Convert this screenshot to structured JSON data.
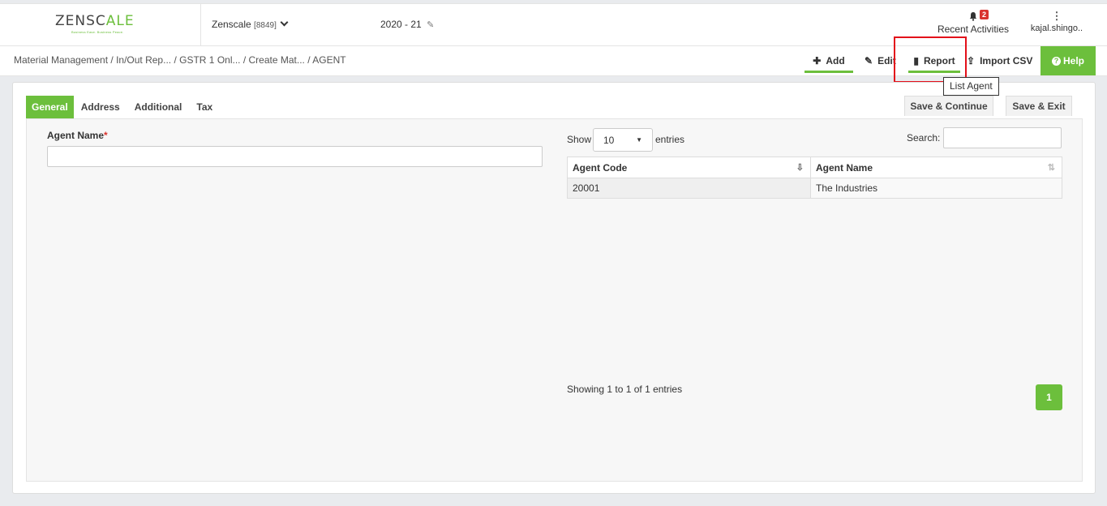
{
  "header": {
    "logo": {
      "prefix": "ZENSC",
      "accent": "A",
      "suffix": "LE",
      "tagline": "Business Ease. Business Peace."
    },
    "company": {
      "name": "Zenscale",
      "code": "[8849]"
    },
    "financial_year": "2020 - 21",
    "recent_activities": {
      "label": "Recent Activities",
      "count": "2",
      "icon": "bell-icon"
    },
    "user": {
      "name": "kajal.shingo..",
      "icon": "more-vertical-icon"
    }
  },
  "breadcrumb": {
    "items": [
      "Material Management",
      "In/Out Rep...",
      "GSTR 1 Onl...",
      "Create Mat...",
      "AGENT"
    ]
  },
  "toolbar": {
    "add": "Add",
    "edit": "Edit",
    "report": "Report",
    "import_csv": "Import CSV",
    "help": "Help",
    "tooltip": "List Agent"
  },
  "tabs": [
    "General",
    "Address",
    "Additional",
    "Tax"
  ],
  "actions": {
    "save_continue": "Save & Continue",
    "save_exit": "Save & Exit"
  },
  "form": {
    "agent_name_label": "Agent Name",
    "required_mark": "*",
    "agent_name_value": ""
  },
  "table": {
    "show_label": "Show",
    "entries_value": "10",
    "entries_label": "entries",
    "search_label": "Search:",
    "search_value": "",
    "columns": [
      "Agent Code",
      "Agent Name"
    ],
    "rows": [
      [
        "20001",
        "The Industries"
      ]
    ],
    "info": "Showing 1 to 1 of 1 entries",
    "current_page": "1"
  },
  "colors": {
    "accent": "#6cbf3c",
    "highlight": "#e3101a",
    "badge": "#d9332e"
  }
}
